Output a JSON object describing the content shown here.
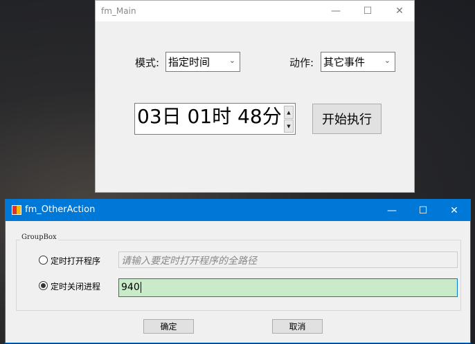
{
  "main_window": {
    "title": "fm_Main",
    "mode_label": "模式:",
    "mode_value": "指定时间",
    "action_label": "动作:",
    "action_value": "其它事件",
    "time_value": "03日 01时 48分",
    "start_button": "开始执行"
  },
  "other_window": {
    "title": "fm_OtherAction",
    "groupbox_label": "GroupBox",
    "option_open": {
      "label": "定时打开程序",
      "placeholder": "请输入要定时打开程序的全路径",
      "checked": false
    },
    "option_close": {
      "label": "定时关闭进程",
      "value": "940",
      "checked": true
    },
    "ok_button": "确定",
    "cancel_button": "取消"
  },
  "glyphs": {
    "minimize": "—",
    "maximize": "☐",
    "close": "✕",
    "chevron": "⌄",
    "up": "▲",
    "down": "▼"
  }
}
